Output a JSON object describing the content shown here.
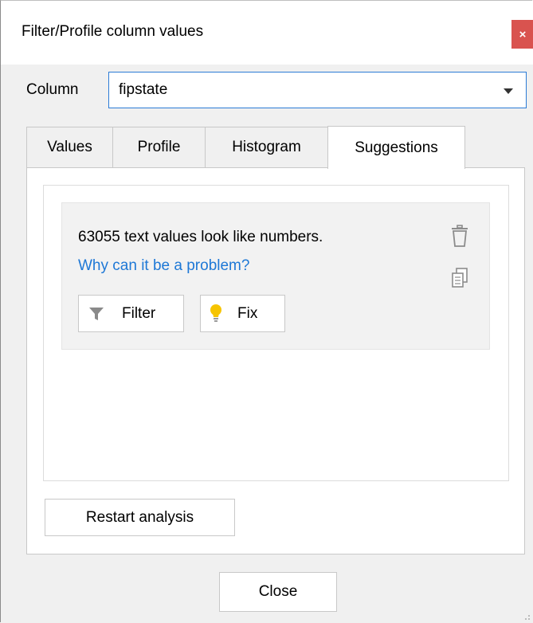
{
  "window": {
    "title": "Filter/Profile column values",
    "close_glyph": "×"
  },
  "column": {
    "label": "Column",
    "selected": "fipstate"
  },
  "tabs": [
    {
      "label": "Values",
      "active": false
    },
    {
      "label": "Profile",
      "active": false
    },
    {
      "label": "Histogram",
      "active": false
    },
    {
      "label": "Suggestions",
      "active": true
    }
  ],
  "suggestion": {
    "message": "63055 text values look like numbers.",
    "link": "Why can it be a problem?",
    "filter_label": "Filter",
    "fix_label": "Fix"
  },
  "buttons": {
    "restart": "Restart analysis",
    "close": "Close"
  },
  "colors": {
    "link": "#1e78d6",
    "close_red": "#d9534f",
    "bulb": "#f6c400",
    "accent_border": "#2b7bd6"
  }
}
